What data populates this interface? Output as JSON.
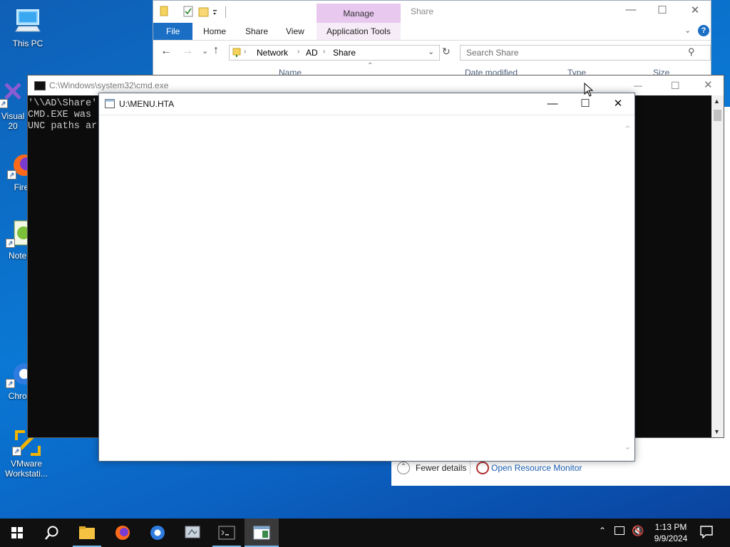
{
  "desktop": {
    "icons": [
      {
        "label": "This PC"
      },
      {
        "label": "Visual\n20"
      },
      {
        "label": "Fire"
      },
      {
        "label": "Notep"
      },
      {
        "label": "Chron"
      },
      {
        "label": "VMware\nWorkstati..."
      }
    ]
  },
  "explorer": {
    "title": "Share",
    "context_tab": "Manage",
    "tabs": [
      "File",
      "Home",
      "Share",
      "View",
      "Application Tools"
    ],
    "breadcrumb": [
      "Network",
      "AD",
      "Share"
    ],
    "search_placeholder": "Search Share",
    "columns": [
      "Name",
      "Date modified",
      "Type",
      "Size"
    ],
    "accent": "#1a6fc4",
    "manage_color": "#e9c8f0"
  },
  "cmd": {
    "title": "C:\\Windows\\system32\\cmd.exe",
    "lines": [
      "'\\\\AD\\Share'",
      "CMD.EXE was",
      "UNC paths ar"
    ]
  },
  "hta": {
    "title": "U:\\MENU.HTA"
  },
  "taskmgr": {
    "fewer_details": "Fewer details",
    "resource_monitor": "Open Resource Monitor"
  },
  "taskbar": {
    "time": "1:13 PM",
    "date": "9/9/2024"
  }
}
